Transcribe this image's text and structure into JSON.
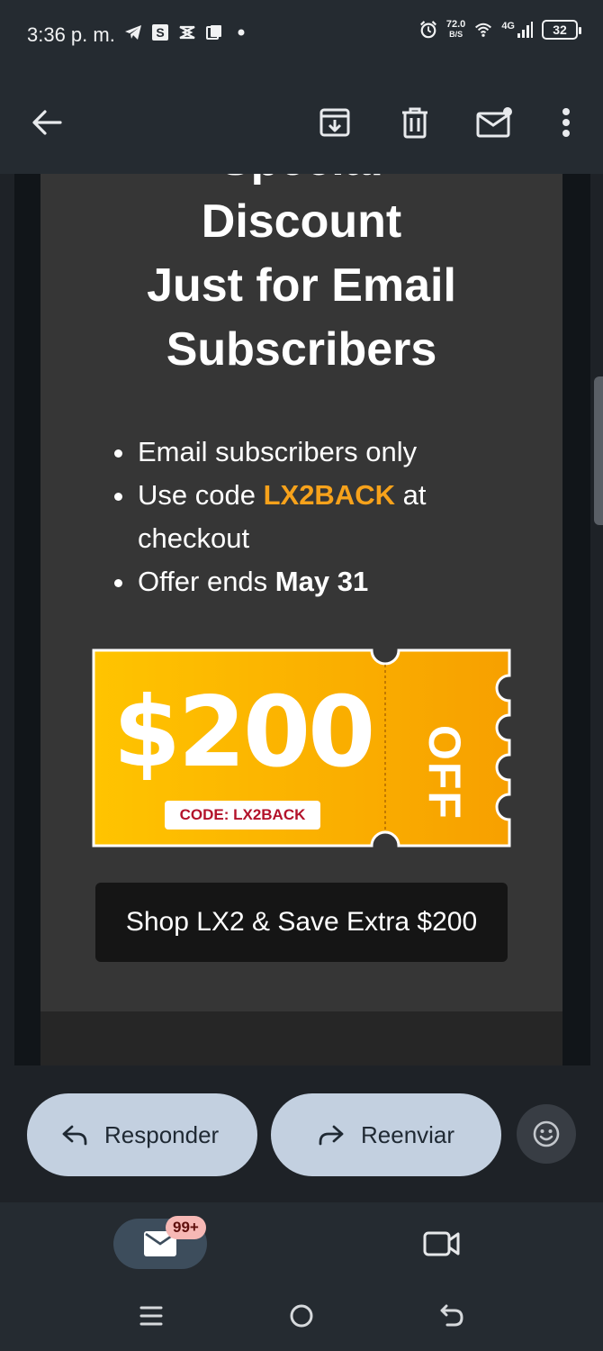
{
  "status_bar": {
    "time": "3:36 p. m.",
    "net_speed_value": "72.0",
    "net_speed_unit": "B/S",
    "signal_label": "4G",
    "battery": "32",
    "left_icons": [
      "telegram-icon",
      "s-app-icon",
      "capcut-icon",
      "gallery-icon",
      "dot-icon"
    ]
  },
  "toolbar": {
    "icons": [
      "back-arrow-icon",
      "archive-icon",
      "delete-icon",
      "mark-unread-icon",
      "more-vert-icon"
    ]
  },
  "email": {
    "headline_partial": "Special",
    "headline_line1": "Discount",
    "headline_line2": "Just for Email",
    "headline_line3": "Subscribers",
    "bullets": {
      "b1": "Email subscribers only",
      "b2_prefix": "Use code ",
      "b2_code": "LX2BACK",
      "b2_suffix": " at checkout",
      "b3_prefix": "Offer ends ",
      "b3_date": "May 31"
    },
    "coupon": {
      "amount": "$200",
      "off": "OFF",
      "code_label": "CODE: LX2BACK",
      "gradient_start": "#ffc400",
      "gradient_end": "#f7a000"
    },
    "cta_label": "Shop LX2 & Save Extra $200",
    "accent_color": "#f7a21b"
  },
  "actions": {
    "reply_label": "Responder",
    "forward_label": "Reenviar"
  },
  "bottom_nav": {
    "mail_badge": "99+",
    "tabs": [
      "mail-icon",
      "meet-video-icon"
    ]
  }
}
